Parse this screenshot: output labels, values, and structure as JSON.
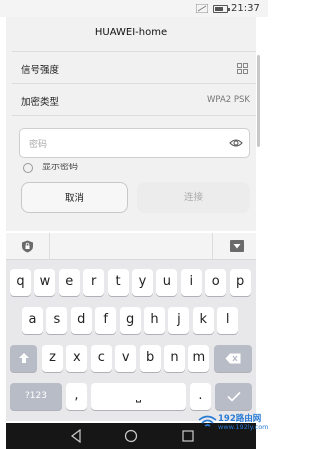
{
  "status_bar": {
    "time": "21:37",
    "battery_level": 0.55
  },
  "dialog": {
    "title": "HUAWEI-home",
    "rows": [
      {
        "label": "信号强度",
        "value_icon": "wifi-qr-icon"
      },
      {
        "label": "加密类型",
        "value": "WPA2 PSK"
      }
    ],
    "password": {
      "placeholder": "密码",
      "value": ""
    },
    "show_password_label": "显示密码",
    "cancel_label": "取消",
    "connect_label": "连接"
  },
  "keyboard": {
    "row1": [
      "q",
      "w",
      "e",
      "r",
      "t",
      "y",
      "u",
      "i",
      "o",
      "p"
    ],
    "row2": [
      "a",
      "s",
      "d",
      "f",
      "g",
      "h",
      "j",
      "k",
      "l"
    ],
    "row3": [
      "z",
      "x",
      "c",
      "v",
      "b",
      "n",
      "m"
    ],
    "sym_label": "?123",
    "comma": ",",
    "period": ".",
    "space_label": "⎵",
    "shift_icon": "shift-arrow-icon",
    "backspace_icon": "backspace-icon",
    "enter_icon": "checkmark-icon"
  },
  "watermark": {
    "line1": "192路由网",
    "line2": "www.192ly.com"
  },
  "colors": {
    "accent": "#2a7bd6",
    "key_dark": "#b8bcc6"
  }
}
